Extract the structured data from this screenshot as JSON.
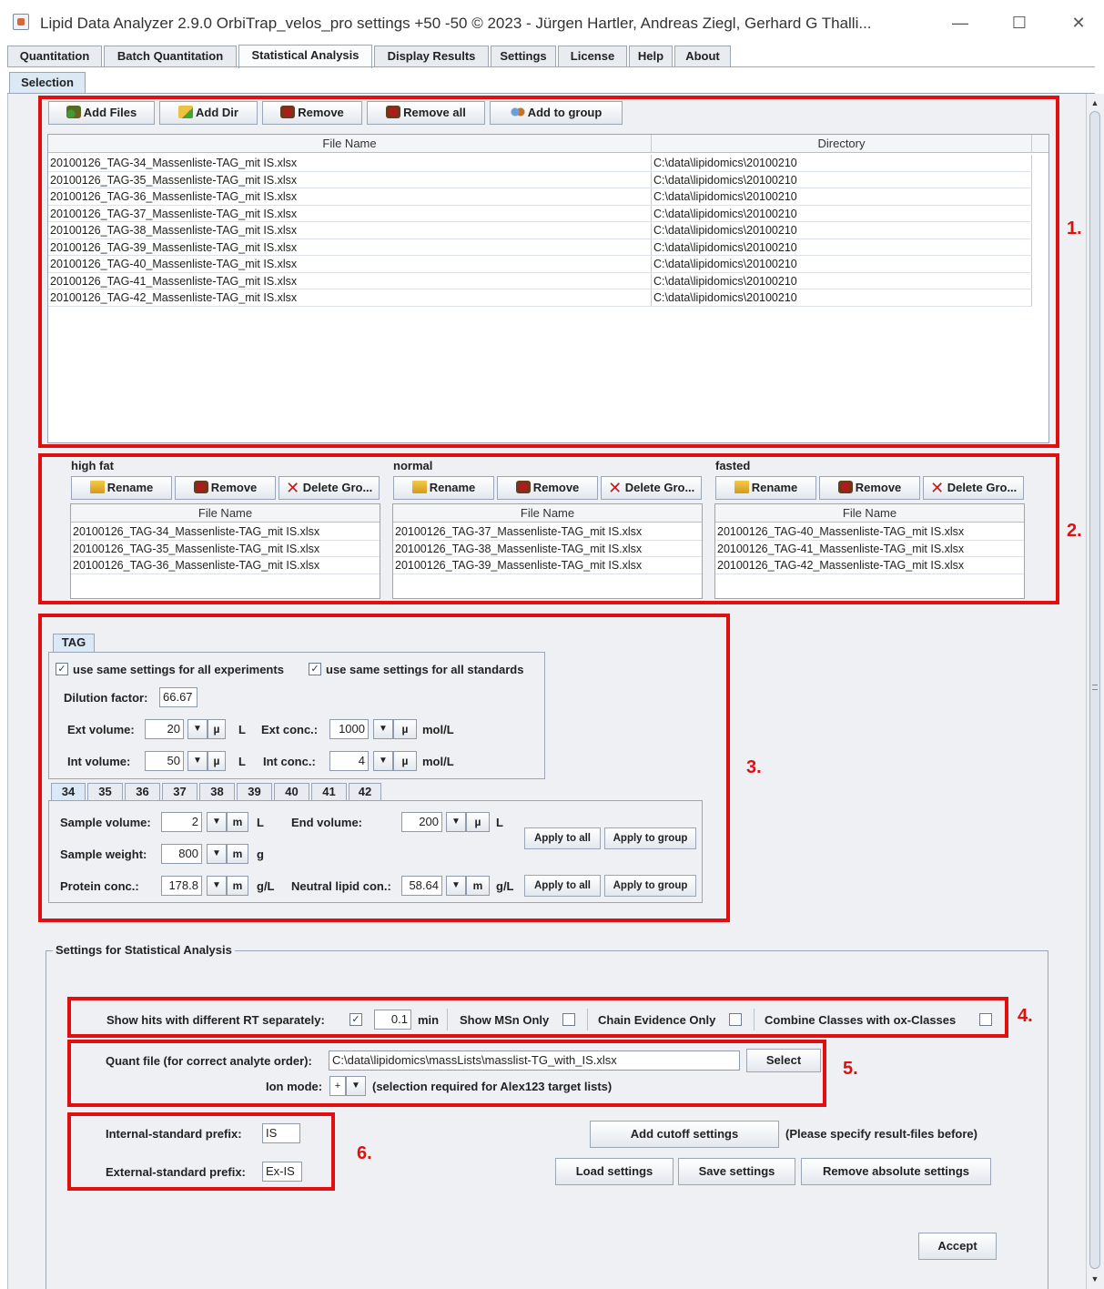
{
  "window": {
    "title": "Lipid Data Analyzer 2.9.0   OrbiTrap_velos_pro settings  +50 -50        © 2023 - Jürgen Hartler, Andreas Ziegl, Gerhard G Thalli...",
    "minimize": "—",
    "maximize": "☐",
    "close": "✕"
  },
  "main_tabs": [
    "Quantitation",
    "Batch Quantitation",
    "Statistical Analysis",
    "Display Results",
    "Settings",
    "License",
    "Help",
    "About"
  ],
  "sub_tab": "Selection",
  "toolbar": {
    "add_files": "Add Files",
    "add_dir": "Add Dir",
    "remove": "Remove",
    "remove_all": "Remove all",
    "add_to_group": "Add to group"
  },
  "files_table": {
    "headers": [
      "File Name",
      "Directory"
    ],
    "rows": [
      [
        "20100126_TAG-34_Massenliste-TAG_mit IS.xlsx",
        "C:\\data\\lipidomics\\20100210"
      ],
      [
        "20100126_TAG-35_Massenliste-TAG_mit IS.xlsx",
        "C:\\data\\lipidomics\\20100210"
      ],
      [
        "20100126_TAG-36_Massenliste-TAG_mit IS.xlsx",
        "C:\\data\\lipidomics\\20100210"
      ],
      [
        "20100126_TAG-37_Massenliste-TAG_mit IS.xlsx",
        "C:\\data\\lipidomics\\20100210"
      ],
      [
        "20100126_TAG-38_Massenliste-TAG_mit IS.xlsx",
        "C:\\data\\lipidomics\\20100210"
      ],
      [
        "20100126_TAG-39_Massenliste-TAG_mit IS.xlsx",
        "C:\\data\\lipidomics\\20100210"
      ],
      [
        "20100126_TAG-40_Massenliste-TAG_mit IS.xlsx",
        "C:\\data\\lipidomics\\20100210"
      ],
      [
        "20100126_TAG-41_Massenliste-TAG_mit IS.xlsx",
        "C:\\data\\lipidomics\\20100210"
      ],
      [
        "20100126_TAG-42_Massenliste-TAG_mit IS.xlsx",
        "C:\\data\\lipidomics\\20100210"
      ]
    ]
  },
  "group_buttons": {
    "rename": "Rename",
    "remove": "Remove",
    "delete_group": "Delete Gro..."
  },
  "groups": [
    {
      "name": "high fat",
      "header": "File Name",
      "files": [
        "20100126_TAG-34_Massenliste-TAG_mit IS.xlsx",
        "20100126_TAG-35_Massenliste-TAG_mit IS.xlsx",
        "20100126_TAG-36_Massenliste-TAG_mit IS.xlsx"
      ]
    },
    {
      "name": "normal",
      "header": "File Name",
      "files": [
        "20100126_TAG-37_Massenliste-TAG_mit IS.xlsx",
        "20100126_TAG-38_Massenliste-TAG_mit IS.xlsx",
        "20100126_TAG-39_Massenliste-TAG_mit IS.xlsx"
      ]
    },
    {
      "name": "fasted",
      "header": "File Name",
      "files": [
        "20100126_TAG-40_Massenliste-TAG_mit IS.xlsx",
        "20100126_TAG-41_Massenliste-TAG_mit IS.xlsx",
        "20100126_TAG-42_Massenliste-TAG_mit IS.xlsx"
      ]
    }
  ],
  "class_settings": {
    "class_tab": "TAG",
    "same_exp_label": "use same settings for all experiments",
    "same_std_label": "use same settings for all standards",
    "check_mark": "✓",
    "dilution_label": "Dilution factor:",
    "dilution_value": "66.67",
    "ext_volume_label": "Ext volume:",
    "ext_volume_value": "20",
    "ext_conc_label": "Ext conc.:",
    "ext_conc_value": "1000",
    "int_volume_label": "Int volume:",
    "int_volume_value": "50",
    "int_conc_label": "Int conc.:",
    "int_conc_value": "4",
    "micro": "µ",
    "milli": "m",
    "unit_L": "L",
    "unit_molL": "mol/L",
    "unit_g": "g",
    "unit_gL": "g/L",
    "dropdown_arrow": "▼"
  },
  "experiment_tabs": [
    "34",
    "35",
    "36",
    "37",
    "38",
    "39",
    "40",
    "41",
    "42"
  ],
  "experiment_settings": {
    "sample_volume_label": "Sample volume:",
    "sample_volume_value": "2",
    "end_volume_label": "End volume:",
    "end_volume_value": "200",
    "sample_weight_label": "Sample weight:",
    "sample_weight_value": "800",
    "protein_label": "Protein conc.:",
    "protein_value": "178.8",
    "neutral_lipid_label": "Neutral lipid con.:",
    "neutral_lipid_value": "58.64",
    "apply_all": "Apply to all",
    "apply_group": "Apply to group"
  },
  "stat_settings": {
    "title": "Settings for Statistical Analysis",
    "show_hits_label": "Show hits with different RT separately:",
    "rt_value": "0.1",
    "rt_unit": "min",
    "msn_only_label": "Show MSn Only",
    "chain_evidence_label": "Chain Evidence Only",
    "combine_label": "Combine Classes with ox-Classes",
    "quant_file_label": "Quant file (for correct analyte order):",
    "quant_file_value": "C:\\data\\lipidomics\\massLists\\masslist-TG_with_IS.xlsx",
    "select": "Select",
    "ion_mode_label": "Ion mode:",
    "ion_mode_value": "+",
    "ion_mode_note": "(selection required for Alex123 target lists)",
    "internal_prefix_label": "Internal-standard prefix:",
    "internal_prefix_value": "IS",
    "external_prefix_label": "External-standard prefix:",
    "external_prefix_value": "Ex-IS",
    "add_cutoff": "Add cutoff settings",
    "cutoff_note": "(Please specify result-files before)",
    "load_settings": "Load settings",
    "save_settings": "Save settings",
    "remove_absolute": "Remove absolute settings",
    "accept": "Accept"
  },
  "annotations": [
    "1.",
    "2.",
    "3.",
    "4.",
    "5.",
    "6."
  ],
  "colors": {
    "annotation_red": "#e01010",
    "panel_bg": "#eef0f3",
    "active_tab": "#dbe8f6"
  }
}
